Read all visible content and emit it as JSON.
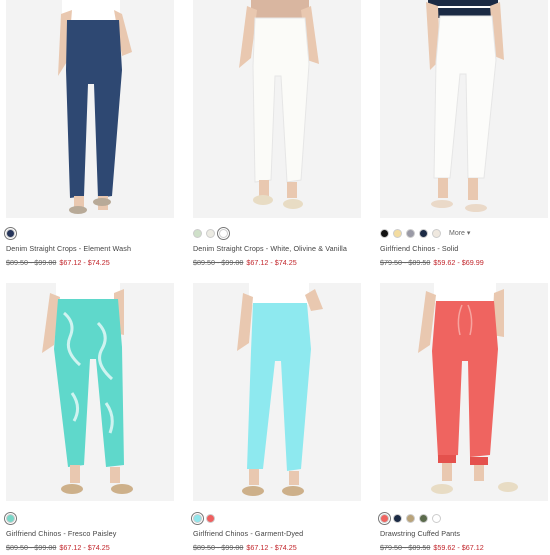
{
  "products": [
    {
      "name": "Denim Straight Crops - Element Wash",
      "was_price": "$89.50 - $99.00",
      "sale_price": "$67.12 - $74.25",
      "pants_color": "#2e4872",
      "swatches": [
        "#26355a"
      ],
      "selected_swatch": 0,
      "more_label": ""
    },
    {
      "name": "Denim Straight Crops - White, Olivine & Vanilla",
      "was_price": "$89.50 - $99.00",
      "sale_price": "$67.12 - $74.25",
      "pants_color": "#fbfbf8",
      "swatches": [
        "#cfe0c9",
        "#ecebe3",
        "#ffffff"
      ],
      "selected_swatch": 2,
      "more_label": ""
    },
    {
      "name": "Girlfriend Chinos - Solid",
      "was_price": "$79.50 - $89.50",
      "sale_price": "$59.62 - $69.99",
      "pants_color": "#fcfcfa",
      "swatches": [
        "#111111",
        "#f3dca0",
        "#9a9aa6",
        "#1b2a44",
        "#efe8df"
      ],
      "selected_swatch": -1,
      "more_label": "More ▾"
    },
    {
      "name": "Girlfriend Chinos - Fresco Paisley",
      "was_price": "$89.50 - $99.00",
      "sale_price": "$67.12 - $74.25",
      "pants_color": "#5fd8cb",
      "swatches": [
        "#79d7c8"
      ],
      "selected_swatch": 0,
      "more_label": ""
    },
    {
      "name": "Girlfriend Chinos - Garment-Dyed",
      "was_price": "$89.50 - $99.00",
      "sale_price": "$67.12 - $74.25",
      "pants_color": "#8ee9ef",
      "swatches": [
        "#8fe6ec",
        "#ef5f5f"
      ],
      "selected_swatch": 0,
      "more_label": ""
    },
    {
      "name": "Drawstring Cuffed Pants",
      "was_price": "$79.50 - $89.50",
      "sale_price": "$59.62 - $67.12",
      "pants_color": "#ef6460",
      "swatches": [
        "#ef6460",
        "#1b2a44",
        "#b9a37a",
        "#5b6b4c",
        "#ffffff"
      ],
      "selected_swatch": 0,
      "more_label": ""
    }
  ]
}
